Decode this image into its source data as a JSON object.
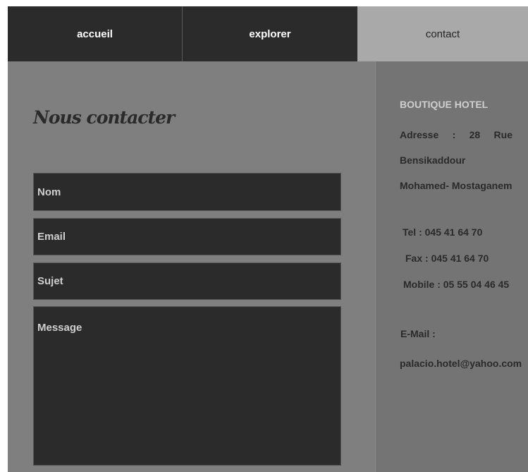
{
  "nav": {
    "items": [
      {
        "label": "accueil",
        "active": false
      },
      {
        "label": "explorer",
        "active": false
      },
      {
        "label": "contact",
        "active": true
      }
    ]
  },
  "form": {
    "title": "Nous contacter",
    "name_placeholder": "Nom",
    "email_placeholder": "Email",
    "subject_placeholder": "Sujet",
    "message_placeholder": "Message"
  },
  "contact_info": {
    "hotel_name": "BOUTIQUE HOTEL",
    "address": "Adresse : 28 Rue Bensikaddour Mohamed- Mostaganem",
    "tel": "Tel : 045 41 64 70",
    "fax": "Fax : 045 41 64 70",
    "mobile": "Mobile : 05 55 04 46 45",
    "email_label": "E-Mail :",
    "email_value": "palacio.hotel@yahoo.com"
  },
  "colors": {
    "nav_bg": "#2b2b2b",
    "nav_active_bg": "#a9a9a9",
    "page_bg": "#7f7f7f",
    "field_bg": "#2b2b2b",
    "hotel_name": "#cfcfcf"
  }
}
